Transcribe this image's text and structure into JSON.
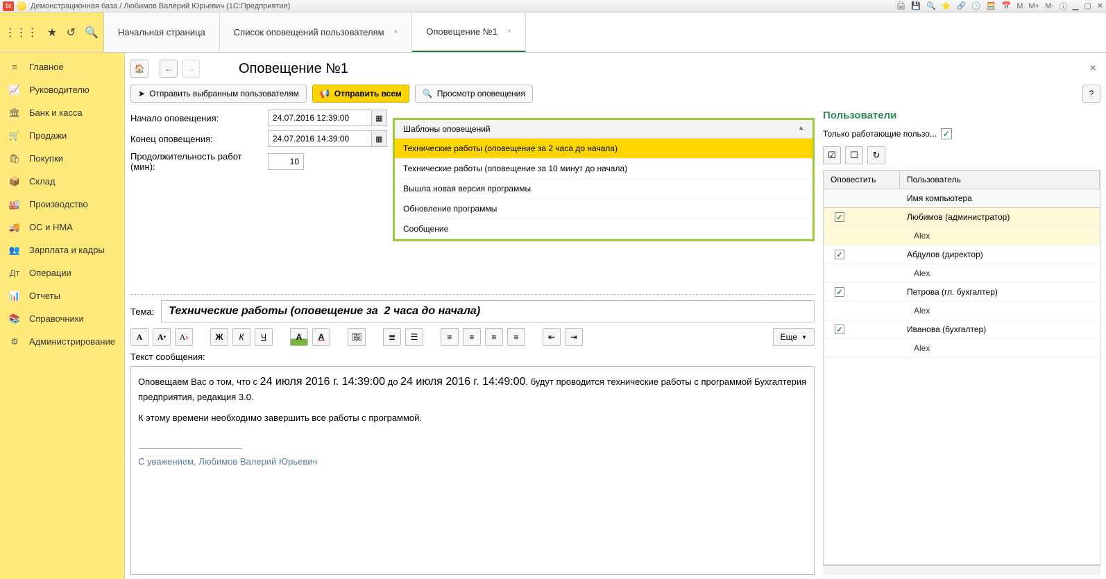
{
  "titlebar": {
    "app_badge": "1c",
    "title": "Демонстрационная база / Любимов Валерий Юрьевич  (1С:Предприятие)",
    "m_labels": [
      "M",
      "M+",
      "M-"
    ]
  },
  "tabs": [
    {
      "label": "Начальная страница",
      "closable": false
    },
    {
      "label": "Список оповещений пользователям",
      "closable": true
    },
    {
      "label": "Оповещение №1",
      "closable": true,
      "active": true
    }
  ],
  "sidebar": {
    "items": [
      {
        "icon": "≡",
        "label": "Главное"
      },
      {
        "icon": "📈",
        "label": "Руководителю"
      },
      {
        "icon": "🏛",
        "label": "Банк и касса"
      },
      {
        "icon": "🛒",
        "label": "Продажи"
      },
      {
        "icon": "🛍",
        "label": "Покупки"
      },
      {
        "icon": "📦",
        "label": "Склад"
      },
      {
        "icon": "🏭",
        "label": "Производство"
      },
      {
        "icon": "🚚",
        "label": "ОС и НМА"
      },
      {
        "icon": "👥",
        "label": "Зарплата и кадры"
      },
      {
        "icon": "Дт",
        "label": "Операции"
      },
      {
        "icon": "📊",
        "label": "Отчеты"
      },
      {
        "icon": "📚",
        "label": "Справочники"
      },
      {
        "icon": "⚙",
        "label": "Администрирование"
      }
    ]
  },
  "page": {
    "title": "Оповещение №1"
  },
  "toolbar": {
    "send_selected": "Отправить выбранным пользователям",
    "send_all": "Отправить всем",
    "preview": "Просмотр оповещения",
    "help": "?"
  },
  "form": {
    "start_label": "Начало оповещения:",
    "start_value": "24.07.2016 12:39:00",
    "end_label": "Конец оповещения:",
    "end_value": "24.07.2016 14:39:00",
    "duration_label": "Продолжительность работ (мин):",
    "duration_value": "10",
    "subject_label": "Тема:",
    "subject_value": "Технические работы (оповещение за  2 часа до начала)",
    "message_label": "Текст сообщения:",
    "more_label": "Еще"
  },
  "dropdown": {
    "header": "Шаблоны оповещений",
    "items": [
      {
        "label": "Технические работы (оповещение за  2 часа до начала)",
        "selected": true
      },
      {
        "label": "Технические работы (оповещение за 10 минут до начала)"
      },
      {
        "label": "Вышла новая версия программы"
      },
      {
        "label": "Обновление программы"
      },
      {
        "label": "Сообщение"
      }
    ]
  },
  "message": {
    "line1_pre": "Оповещаем Вас о том, что с ",
    "date1": "24 июля 2016 г. 14:39:00",
    "line1_mid": " до ",
    "date2": "24 июля 2016 г. 14:49:00",
    "line1_post": ", будут проводится технические работы с программой Бухгалтерия предприятия, редакция 3.0.",
    "line2": "К этому времени необходимо завершить все работы с программой.",
    "sig_sep": "---------------------------------------------",
    "signature": "С уважением, Любимов Валерий Юрьевич"
  },
  "users": {
    "title": "Пользователи",
    "filter_label": "Только работающие пользо...",
    "filter_checked": "✓",
    "col_notify": "Оповестить",
    "col_user": "Пользователь",
    "col_computer": "Имя компьютера",
    "rows": [
      {
        "checked": true,
        "user": "Любимов (администратор)",
        "computer": "Alex",
        "highlight": true
      },
      {
        "checked": true,
        "user": "Абдулов (директор)",
        "computer": "Alex"
      },
      {
        "checked": true,
        "user": "Петрова (гл. бухгалтер)",
        "computer": "Alex"
      },
      {
        "checked": true,
        "user": "Иванова (бухгалтер)",
        "computer": "Alex"
      }
    ]
  }
}
